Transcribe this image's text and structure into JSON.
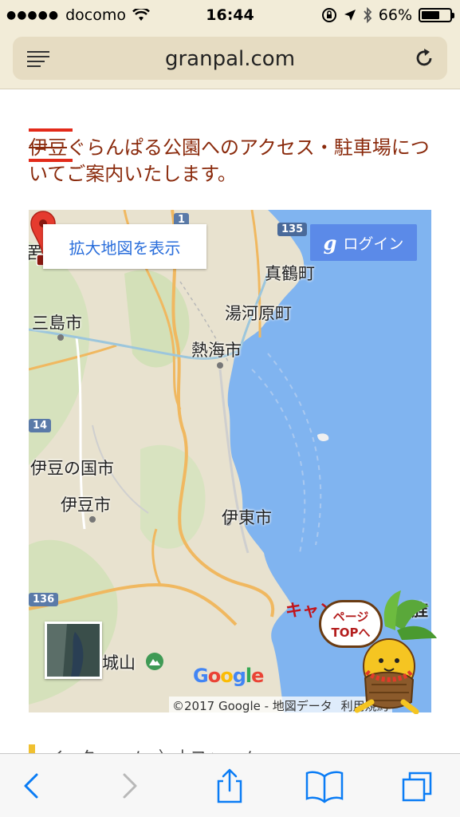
{
  "status_bar": {
    "signal": "●●●●●",
    "carrier": "docomo",
    "time": "16:44",
    "battery_percent": "66%",
    "battery_level": 0.66
  },
  "address_bar": {
    "url": "granpal.com"
  },
  "article": {
    "intro_struck": "伊豆",
    "intro_rest": "ぐらんぱる公園へのアクセス・駐車場についてご案内いたします。"
  },
  "map": {
    "enlarge_button": "拡大地図を表示",
    "login_g": "g",
    "login_button": "ログイン",
    "labels": {
      "manazuru": "真鶴町",
      "yugawara": "湯河原町",
      "mishima": "三島市",
      "atami": "熱海市",
      "izunokuni": "伊豆の国市",
      "izu": "伊豆市",
      "ito": "伊東市",
      "shiroyama": "城山",
      "place": "キャン",
      "partial_left": "罟",
      "partial_right": "旌"
    },
    "road_shields": {
      "r1": "1",
      "r135": "135",
      "r14": "14",
      "r136": "136"
    },
    "logo": "Google",
    "copyright": "©2017 Google - 地図データ",
    "terms": "利用規約"
  },
  "mascot": {
    "bubble_line1": "ページ",
    "bubble_line2": "TOPへ"
  },
  "next_heading": {
    "text": "イヽタ一ーノヽ〉小フゝヽメ"
  },
  "colors": {
    "browser_bar": "#f2ecd8",
    "intro_text": "#8a2a0c",
    "sea": "#80b4f0",
    "ios_blue": "#0a7cf5"
  }
}
